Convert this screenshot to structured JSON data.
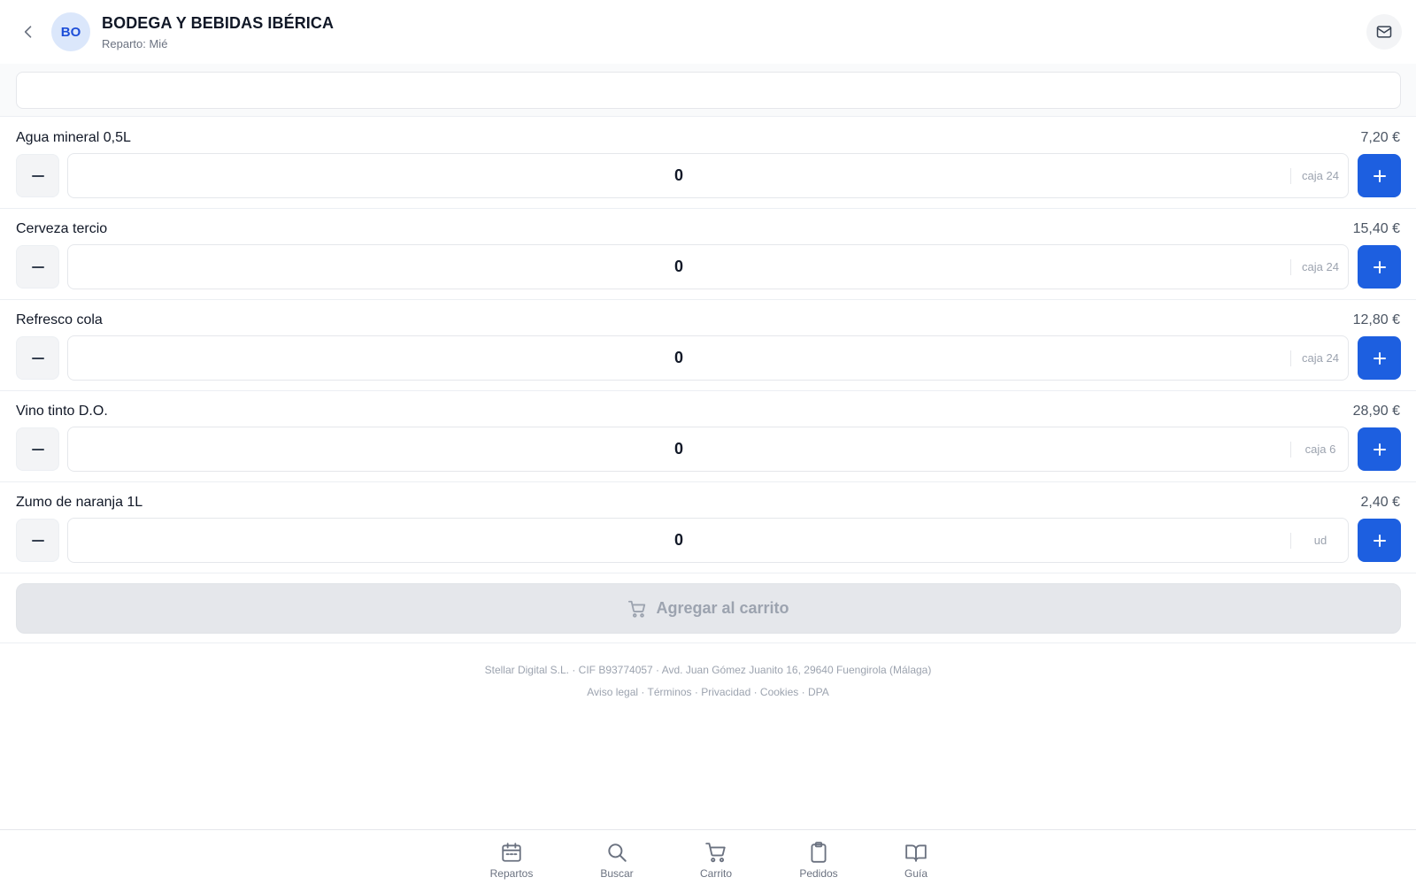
{
  "header": {
    "avatar_initials": "BO",
    "title": "BODEGA Y BEBIDAS IBÉRICA",
    "subtitle": "Reparto: Mié"
  },
  "search": {
    "placeholder": "",
    "value": ""
  },
  "products": [
    {
      "name": "Agua mineral 0,5L",
      "price": "7,20 €",
      "quantity": "0",
      "unit": "caja 24"
    },
    {
      "name": "Cerveza tercio",
      "price": "15,40 €",
      "quantity": "0",
      "unit": "caja 24"
    },
    {
      "name": "Refresco cola",
      "price": "12,80 €",
      "quantity": "0",
      "unit": "caja 24"
    },
    {
      "name": "Vino tinto D.O.",
      "price": "28,90 €",
      "quantity": "0",
      "unit": "caja 6"
    },
    {
      "name": "Zumo de naranja 1L",
      "price": "2,40 €",
      "quantity": "0",
      "unit": "ud"
    }
  ],
  "cart_button": {
    "label": "Agregar al carrito",
    "icon": "cart-icon"
  },
  "legal": {
    "company_line": "Stellar Digital S.L. · CIF B93774057 · Avd. Juan Gómez Juanito 16, 29640 Fuengirola (Málaga)",
    "links": [
      "Aviso legal",
      "Términos",
      "Privacidad",
      "Cookies",
      "DPA"
    ],
    "separator": " · "
  },
  "bottom_nav": [
    {
      "label": "Repartos",
      "icon": "calendar-icon"
    },
    {
      "label": "Buscar",
      "icon": "search-icon"
    },
    {
      "label": "Carrito",
      "icon": "cart-icon"
    },
    {
      "label": "Pedidos",
      "icon": "clipboard-icon"
    },
    {
      "label": "Guía",
      "icon": "book-icon"
    }
  ],
  "colors": {
    "accent": "#1d5fe0",
    "avatar_bg": "#dbe7fb",
    "avatar_text": "#1d4ed8",
    "disabled_button_bg": "#e5e7eb"
  }
}
